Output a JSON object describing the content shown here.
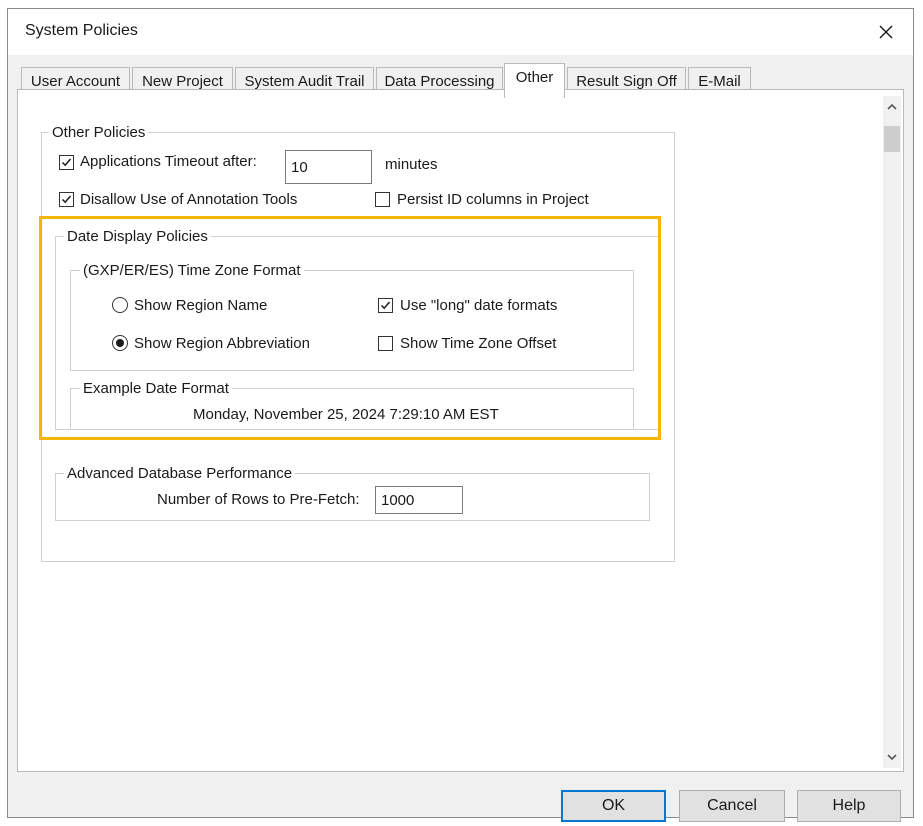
{
  "window": {
    "title": "System Policies",
    "close_icon": "close-icon"
  },
  "tabs": [
    {
      "label": "User Account",
      "active": false
    },
    {
      "label": "New Project",
      "active": false
    },
    {
      "label": "System Audit Trail",
      "active": false
    },
    {
      "label": "Data Processing",
      "active": false
    },
    {
      "label": "Other",
      "active": true
    },
    {
      "label": "Result Sign Off",
      "active": false
    },
    {
      "label": "E-Mail",
      "active": false
    }
  ],
  "other_policies": {
    "legend": "Other Policies",
    "timeout_label": "Applications Timeout after:",
    "timeout_checked": true,
    "timeout_value": "10",
    "timeout_unit": "minutes",
    "disallow_annotation_label": "Disallow Use of Annotation Tools",
    "disallow_annotation_checked": true,
    "persist_id_label": "Persist ID columns in Project",
    "persist_id_checked": false
  },
  "date_display": {
    "legend": "Date Display Policies",
    "tz_format": {
      "legend": "(GXP/ER/ES) Time Zone Format",
      "show_region_name": "Show Region Name",
      "show_region_abbreviation": "Show Region Abbreviation",
      "selected": "Show Region Abbreviation",
      "use_long_formats": "Use \"long\" date formats",
      "use_long_formats_checked": true,
      "show_tz_offset": "Show Time Zone Offset",
      "show_tz_offset_checked": false
    },
    "example": {
      "legend": "Example Date Format",
      "value": "Monday, November 25, 2024 7:29:10 AM EST"
    }
  },
  "advanced_db": {
    "legend": "Advanced Database Performance",
    "prefetch_label": "Number of Rows to Pre-Fetch:",
    "prefetch_value": "1000"
  },
  "buttons": {
    "ok": "OK",
    "cancel": "Cancel",
    "help": "Help"
  },
  "colors": {
    "highlight": "#f5b800",
    "default_button_border": "#0078d7"
  }
}
